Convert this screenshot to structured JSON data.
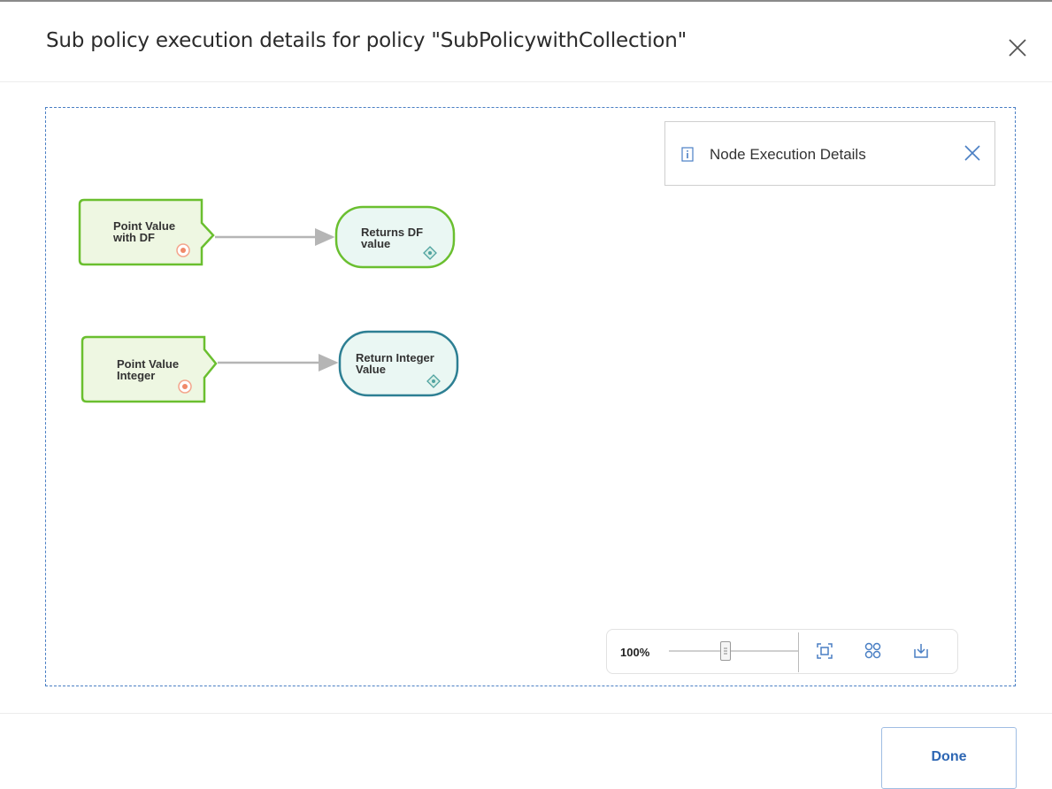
{
  "dialog": {
    "title": "Sub policy execution details for policy \"SubPolicywithCollection\""
  },
  "panel": {
    "title": "Node Execution Details"
  },
  "nodes": [
    {
      "line1": "Point Value",
      "line2": "with DF",
      "type": "input"
    },
    {
      "line1": "Returns DF",
      "line2": "value",
      "type": "action"
    },
    {
      "line1": "Point Value",
      "line2": "Integer",
      "type": "input"
    },
    {
      "line1": "Return Integer",
      "line2": "Value",
      "type": "action"
    }
  ],
  "zoom": {
    "level": "100%"
  },
  "footer": {
    "done_label": "Done"
  },
  "colors": {
    "input_node_border": "#6abf2f",
    "input_node_fill": "#eef7e2",
    "result_node_green_border": "#6abf2f",
    "result_node_teal_border": "#2d7f93",
    "result_node_fill": "#eaf7f3",
    "connector": "#b5b5b5",
    "accent": "#2d66b3",
    "marker": "#f08a6a"
  },
  "icons": [
    "close-icon",
    "info-document-icon",
    "fit-to-screen-icon",
    "grid-layout-icon",
    "download-icon"
  ]
}
